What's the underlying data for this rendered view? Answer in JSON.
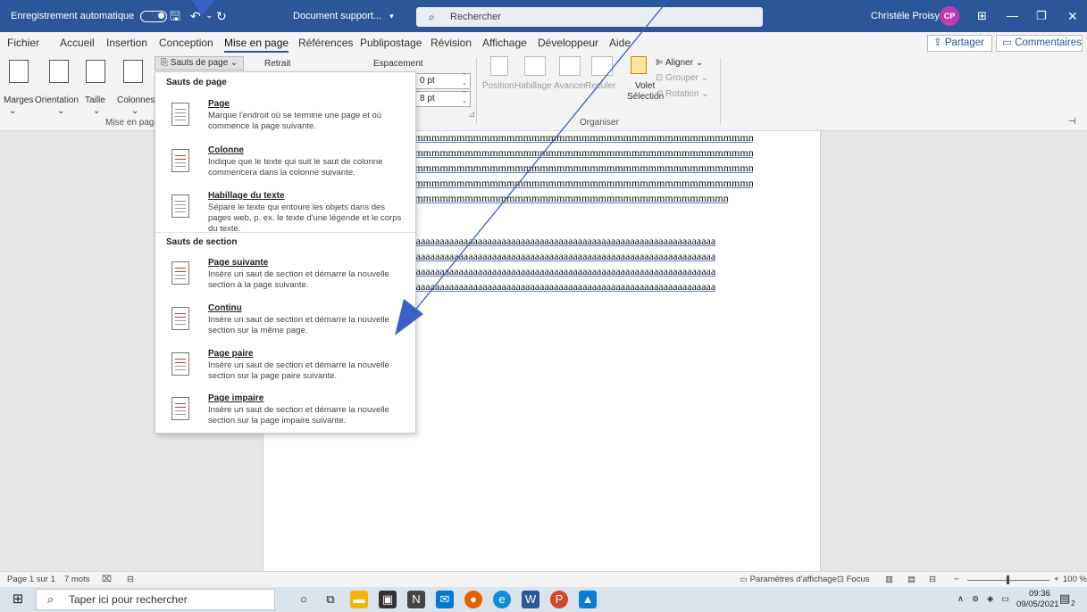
{
  "titlebar": {
    "autosave_label": "Enregistrement automatique",
    "doc_title": "Document support...",
    "search_placeholder": "Rechercher",
    "user_name": "Christèle Proisy",
    "user_initials": "CP"
  },
  "tabs": [
    "Fichier",
    "Accueil",
    "Insertion",
    "Conception",
    "Mise en page",
    "Références",
    "Publipostage",
    "Révision",
    "Affichage",
    "Développeur",
    "Aide"
  ],
  "share_label": "Partager",
  "comments_label": "Commentaires",
  "ribbon": {
    "marges": "Marges",
    "orientation": "Orientation",
    "taille": "Taille",
    "colonnes": "Colonnes",
    "sauts_button": "Sauts de page",
    "retrait": "Retrait",
    "espacement": "Espacement",
    "spacing_before": "0 pt",
    "spacing_after": "8 pt",
    "position": "Position",
    "habillage": "Habillage",
    "avancer": "Avancer",
    "reculer": "Reculer",
    "volet": "Volet",
    "selection": "Sélection",
    "aligner": "Aligner",
    "grouper": "Grouper",
    "rotation": "Rotation",
    "group_mise_en_page": "Mise en page",
    "group_organiser": "Organiser"
  },
  "dropdown": {
    "section1": "Sauts de page",
    "section2": "Sauts de section",
    "items": [
      {
        "title": "Page",
        "desc": "Marque l'endroit où se termine une page et où commence la page suivante."
      },
      {
        "title": "Colonne",
        "desc": "Indique que le texte qui suit le saut de colonne commencera dans la colonne suivante."
      },
      {
        "title": "Habillage du texte",
        "desc": "Sépare le texte qui entoure les objets dans des pages web, p. ex. le texte d'une légende et le corps du texte."
      },
      {
        "title": "Page suivante",
        "desc": "Insère un saut de section et démarre la nouvelle section à la page suivante."
      },
      {
        "title": "Continu",
        "desc": "Insère un saut de section et démarre la nouvelle section sur la même page."
      },
      {
        "title": "Page paire",
        "desc": "Insère un saut de section et démarre la nouvelle section sur la page paire suivante."
      },
      {
        "title": "Page impaire",
        "desc": "Insère un saut de section et démarre la nouvelle section sur la page impaire suivante."
      }
    ]
  },
  "document": {
    "lines_m": [
      "mmmmmmmmmmmmmmmmmmmmmmmmmmmmmmmmmmmmmmmmmm",
      "mmmmmmmmmmmmmmmmmmmmmmmmmmmmmmmmmmmmmmmmmm",
      "mmmmmmmmmmmmmmmmmmmmmmmmmmmmmmmmmmmmmmmmmm",
      "mmmmmmmmmmmmmmmmmmmmmmmmmmmmmmmmmmmmmmmmmm",
      "mmmmmmmmmmmmmmmmmmmmmmmmmmmmmmmmmmmmmmmm"
    ],
    "lines_a": [
      "aaaaaaaaaaaaaaaaaaaaaaaaaaaaaaaaaaaaaaaaaaaaaaaaaaaaaaaaaaaaaaaaa",
      "aaaaaaaaaaaaaaaaaaaaaaaaaaaaaaaaaaaaaaaaaaaaaaaaaaaaaaaaaaaaaaaaa",
      "aaaaaaaaaaaaaaaaaaaaaaaaaaaaaaaaaaaaaaaaaaaaaaaaaaaaaaaaaaaaaaaaa",
      "aaaaaaaaaaaaaaaaaaaaaaaaaaaaaaaaaaaaaaaaaaaaaaaaaaaaaaaaaaaaaaaaa"
    ]
  },
  "status": {
    "page": "Page 1 sur 1",
    "words": "7 mots",
    "display_settings": "Paramètres d'affichage",
    "focus": "Focus",
    "zoom": "100 %"
  },
  "taskbar": {
    "search_placeholder": "Taper ici pour rechercher",
    "time": "09:36",
    "date": "09/05/2021",
    "notifications": "2"
  },
  "colors": {
    "titlebar": "#2b579a",
    "accent": "#2b579a",
    "arrow": "#3a5fc8"
  }
}
